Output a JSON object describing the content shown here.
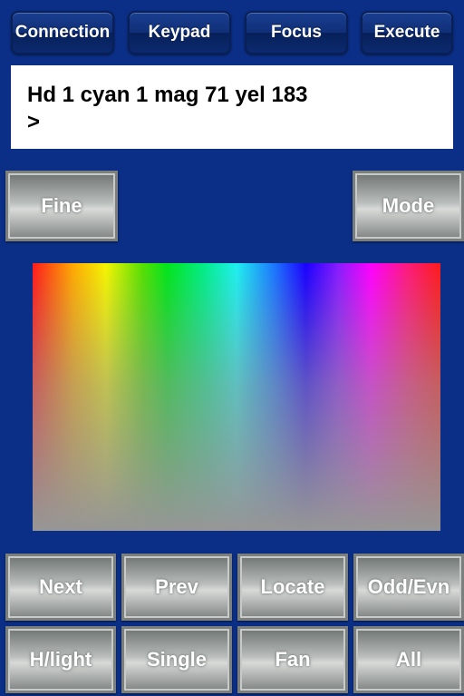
{
  "tabs": {
    "connection": "Connection",
    "keypad": "Keypad",
    "focus": "Focus",
    "execute": "Execute"
  },
  "display": {
    "line1": "Hd 1 cyan 1 mag 71 yel 183",
    "line2": ">"
  },
  "controls": {
    "fine": "Fine",
    "mode": "Mode"
  },
  "buttons": {
    "next": "Next",
    "prev": "Prev",
    "locate": "Locate",
    "odd_even": "Odd/Evn",
    "highlight": "H/light",
    "single": "Single",
    "fan": "Fan",
    "all": "All"
  },
  "colors": {
    "background": "#0b2f86",
    "display_bg": "#ffffff",
    "button_text": "#ffffff"
  }
}
